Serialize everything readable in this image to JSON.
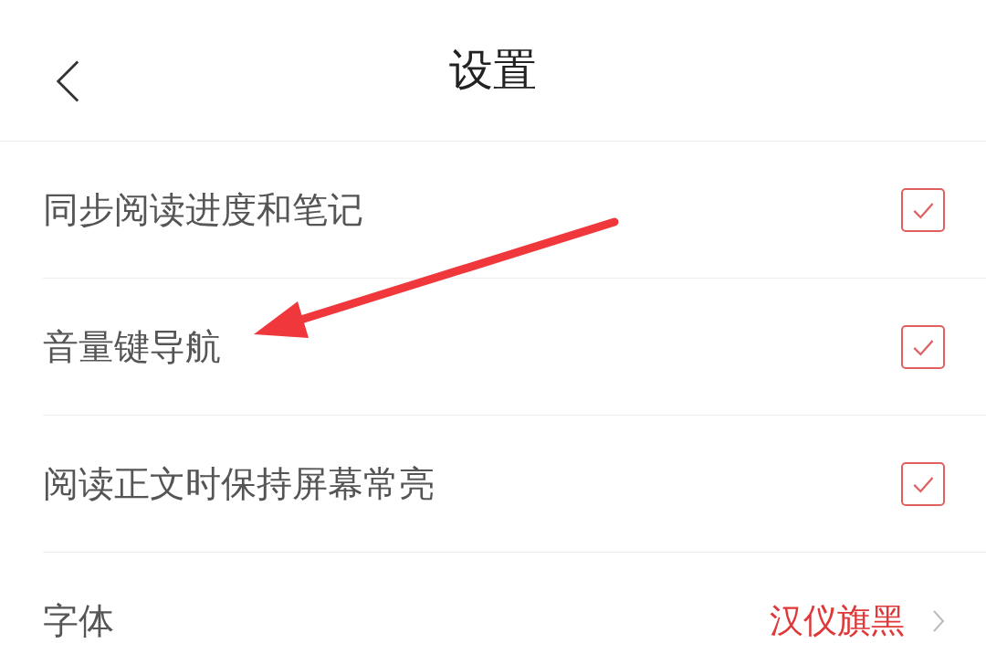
{
  "header": {
    "title": "设置"
  },
  "settings": [
    {
      "kind": "checkbox",
      "label": "同步阅读进度和笔记",
      "checked": true
    },
    {
      "kind": "checkbox",
      "label": "音量键导航",
      "checked": true
    },
    {
      "kind": "checkbox",
      "label": "阅读正文时保持屏幕常亮",
      "checked": true
    },
    {
      "kind": "value",
      "label": "字体",
      "value": "汉仪旗黑"
    }
  ]
}
